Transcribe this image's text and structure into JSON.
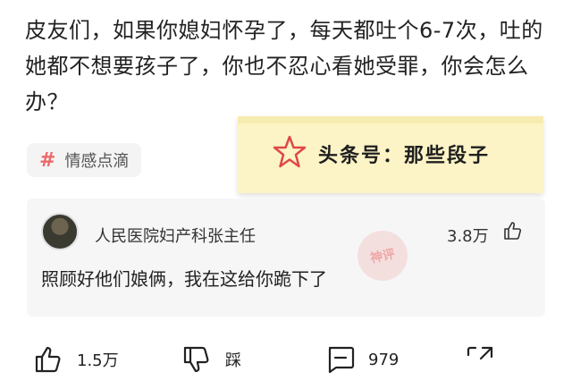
{
  "post": {
    "text": "皮友们，如果你媳妇怀孕了，每天都吐个6-7次，吐的她都不想要孩子了，你也不忍心看她受罪，你会怎么办？"
  },
  "tag": {
    "symbol": "#",
    "label": "情感点滴"
  },
  "sticky": {
    "text": "头条号：那些段子",
    "icon": "star-icon",
    "color": "#fcf4c6"
  },
  "comment": {
    "author": "人民医院妇产科张主任",
    "likes": "3.8万",
    "text": "照顾好他们娘俩，我在这给你跪下了",
    "watermark": "神评",
    "like_icon": "thumbs-up-icon"
  },
  "actions": {
    "like_count": "1.5万",
    "dislike_label": "踩",
    "comment_count": "979",
    "like_icon": "thumbs-up-icon",
    "dislike_icon": "thumbs-down-icon",
    "comment_icon": "comment-icon",
    "share_icon": "share-icon"
  },
  "colors": {
    "accent": "#ec6a6a",
    "text": "#222222"
  }
}
